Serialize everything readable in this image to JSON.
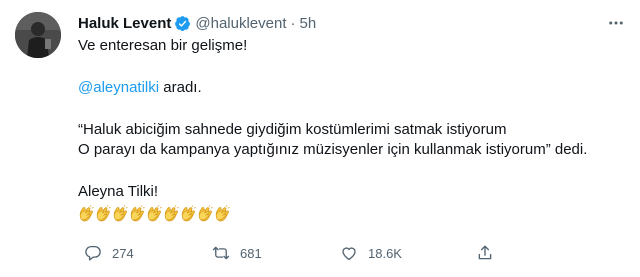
{
  "tweet": {
    "author_name": "Haluk Levent",
    "handle": "@haluklevent",
    "separator": "·",
    "time": "5h",
    "line1": "Ve enteresan bir gelişme!",
    "mention": "@aleynatilki",
    "mention_suffix": " aradı.",
    "quote_line1": "“Haluk abiciğim sahnede giydiğim kostümlerimi satmak istiyorum",
    "quote_line2": "O parayı da kampanya yaptığınız müzisyenler için kullanmak istiyorum” dedi.",
    "closing": "Aleyna Tilki!",
    "clap_count": 9,
    "icons": {
      "verified": "verified-badge-icon",
      "more": "more-icon",
      "clap": "clapping-hands-emoji"
    }
  },
  "actions": {
    "reply_count": "274",
    "retweet_count": "681",
    "like_count": "18.6K"
  },
  "colors": {
    "accent": "#1d9bf0",
    "secondary": "#536471",
    "text": "#0f1419"
  }
}
